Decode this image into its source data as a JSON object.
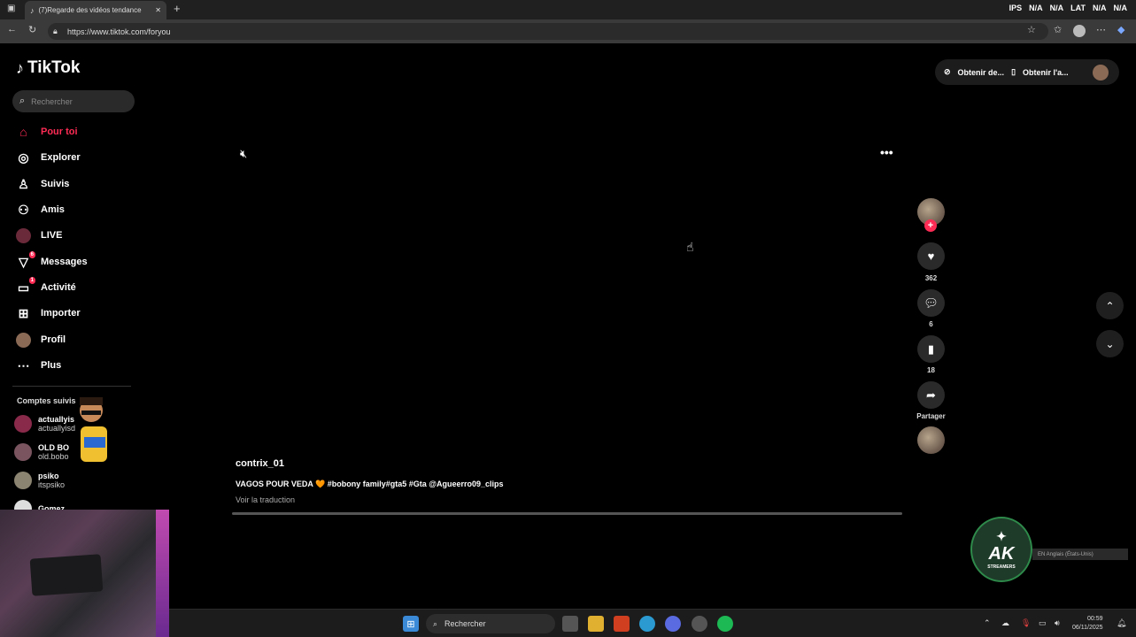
{
  "browser": {
    "tab_title": "(7)Regarde des vidéos tendance",
    "url": "https://www.tiktok.com/foryou",
    "stats": [
      "IPS",
      "N/A",
      "N/A",
      "LAT",
      "N/A",
      "N/A"
    ]
  },
  "brand": {
    "name": "TikTok",
    "accent": "#fe2c55"
  },
  "search": {
    "placeholder": "Rechercher"
  },
  "nav": [
    {
      "label": "Pour toi",
      "icon": "home-icon",
      "active": true
    },
    {
      "label": "Explorer",
      "icon": "compass-icon"
    },
    {
      "label": "Suivis",
      "icon": "user-follow-icon"
    },
    {
      "label": "Amis",
      "icon": "friends-icon"
    },
    {
      "label": "LIVE",
      "icon": "live-icon"
    },
    {
      "label": "Messages",
      "icon": "send-icon",
      "badge": "6"
    },
    {
      "label": "Activité",
      "icon": "activity-icon",
      "badge": "1"
    },
    {
      "label": "Importer",
      "icon": "upload-icon"
    },
    {
      "label": "Profil",
      "icon": "profile-avatar-icon"
    },
    {
      "label": "Plus",
      "icon": "more-icon"
    }
  ],
  "followed": {
    "heading": "Comptes suivis",
    "accounts": [
      {
        "name": "actuallyis",
        "user": "actuallyisd"
      },
      {
        "name": "OLD BO",
        "user": "old.bobo"
      },
      {
        "name": "psiko",
        "user": "itspsiko"
      },
      {
        "name": "Gomez",
        "user": ""
      }
    ]
  },
  "top_actions": {
    "coins": "Obtenir de...",
    "app": "Obtenir l'a..."
  },
  "video": {
    "author": "contrix_01",
    "description": "VAGOS POUR VEDA 🧡 #bobony family#gta5 #Gta @Agueerro09_clips",
    "translate": "Voir la traduction",
    "likes": "362",
    "comments": "6",
    "saves": "18",
    "share_label": "Partager"
  },
  "overlay": {
    "ak_big": "AK",
    "ak_small": "STREAMERS",
    "lang": "EN Anglais (États-Unis)"
  },
  "taskbar": {
    "search": "Rechercher",
    "time": "00:59",
    "date": "06/11/2025"
  }
}
